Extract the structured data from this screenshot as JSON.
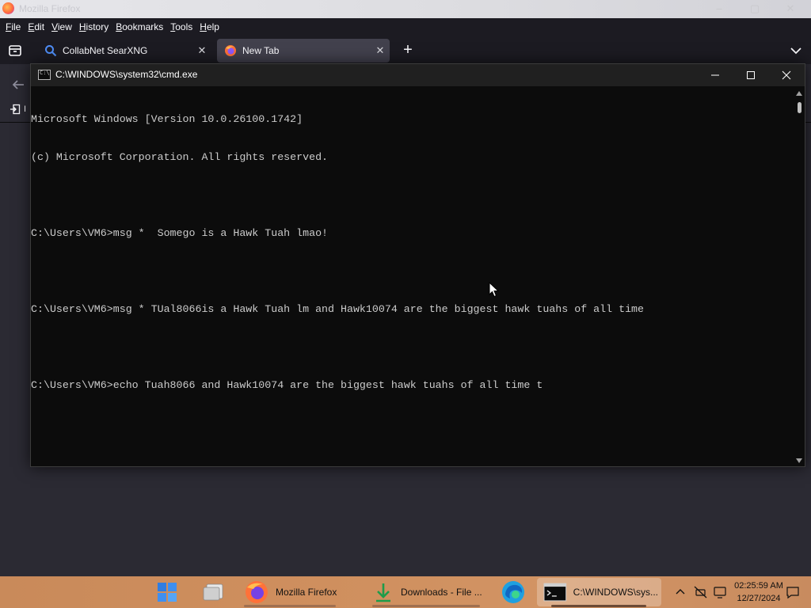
{
  "firefox": {
    "window_title": "Mozilla Firefox",
    "menu": [
      {
        "label": "File",
        "accel": "F",
        "rest": "ile"
      },
      {
        "label": "Edit",
        "accel": "E",
        "rest": "dit"
      },
      {
        "label": "View",
        "accel": "V",
        "rest": "iew"
      },
      {
        "label": "History",
        "accel": "H",
        "rest": "istory"
      },
      {
        "label": "Bookmarks",
        "accel": "B",
        "rest": "ookmarks"
      },
      {
        "label": "Tools",
        "accel": "T",
        "rest": "ools"
      },
      {
        "label": "Help",
        "accel": "H",
        "rest": "elp"
      }
    ],
    "tabs": [
      {
        "label": "CollabNet SearXNG",
        "icon": "search-icon",
        "active": false
      },
      {
        "label": "New Tab",
        "icon": "firefox-icon",
        "active": true
      }
    ],
    "import_label": "I"
  },
  "cmd": {
    "title": "C:\\WINDOWS\\system32\\cmd.exe",
    "icon_text": "C:\\",
    "lines": [
      "Microsoft Windows [Version 10.0.26100.1742]",
      "(c) Microsoft Corporation. All rights reserved.",
      "",
      "C:\\Users\\VM6>msg *  Somego is a Hawk Tuah lmao!",
      "",
      "C:\\Users\\VM6>msg * TUal8066is a Hawk Tuah lm and Hawk10074 are the biggest hawk tuahs of all time",
      "",
      "C:\\Users\\VM6>echo Tuah8066 and Hawk10074 are the biggest hawk tuahs of all time t"
    ]
  },
  "taskbar": {
    "items": [
      {
        "name": "start-button",
        "label": ""
      },
      {
        "name": "file-explorer-button",
        "label": ""
      },
      {
        "name": "firefox-taskbar-button",
        "label": "Mozilla Firefox"
      },
      {
        "name": "downloads-taskbar-button",
        "label": "Downloads - File ..."
      },
      {
        "name": "edge-taskbar-button",
        "label": ""
      },
      {
        "name": "cmd-taskbar-button",
        "label": "C:\\WINDOWS\\sys..."
      }
    ],
    "time": "02:25:59 AM",
    "date": "12/27/2024"
  },
  "colors": {
    "terminal_bg": "#0c0c0c",
    "terminal_text": "#cccccc",
    "firefox_dark": "#1c1b22",
    "taskbar": "#cf8f5e"
  }
}
